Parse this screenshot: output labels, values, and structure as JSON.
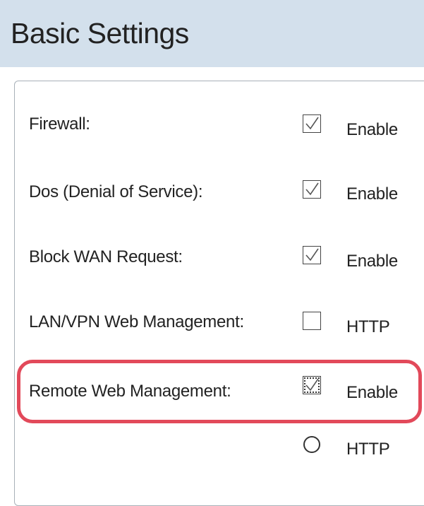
{
  "page_title": "Basic Settings",
  "rows": [
    {
      "label": "Firewall:",
      "option_label": "Enable",
      "control": "checkbox",
      "checked": true
    },
    {
      "label": "Dos (Denial of Service):",
      "option_label": "Enable",
      "control": "checkbox",
      "checked": true
    },
    {
      "label": "Block WAN Request:",
      "option_label": "Enable",
      "control": "checkbox",
      "checked": true
    },
    {
      "label": "LAN/VPN Web Management:",
      "option_label": "HTTP",
      "control": "checkbox",
      "checked": false
    },
    {
      "label": "Remote Web Management:",
      "option_label": "Enable",
      "control": "checkbox",
      "checked": true,
      "highlighted": true
    },
    {
      "label": "",
      "option_label": "HTTP",
      "control": "radio",
      "checked": false
    }
  ],
  "colors": {
    "header_bg": "#d3e0ec",
    "highlight": "#e2495a",
    "text": "#222222"
  }
}
